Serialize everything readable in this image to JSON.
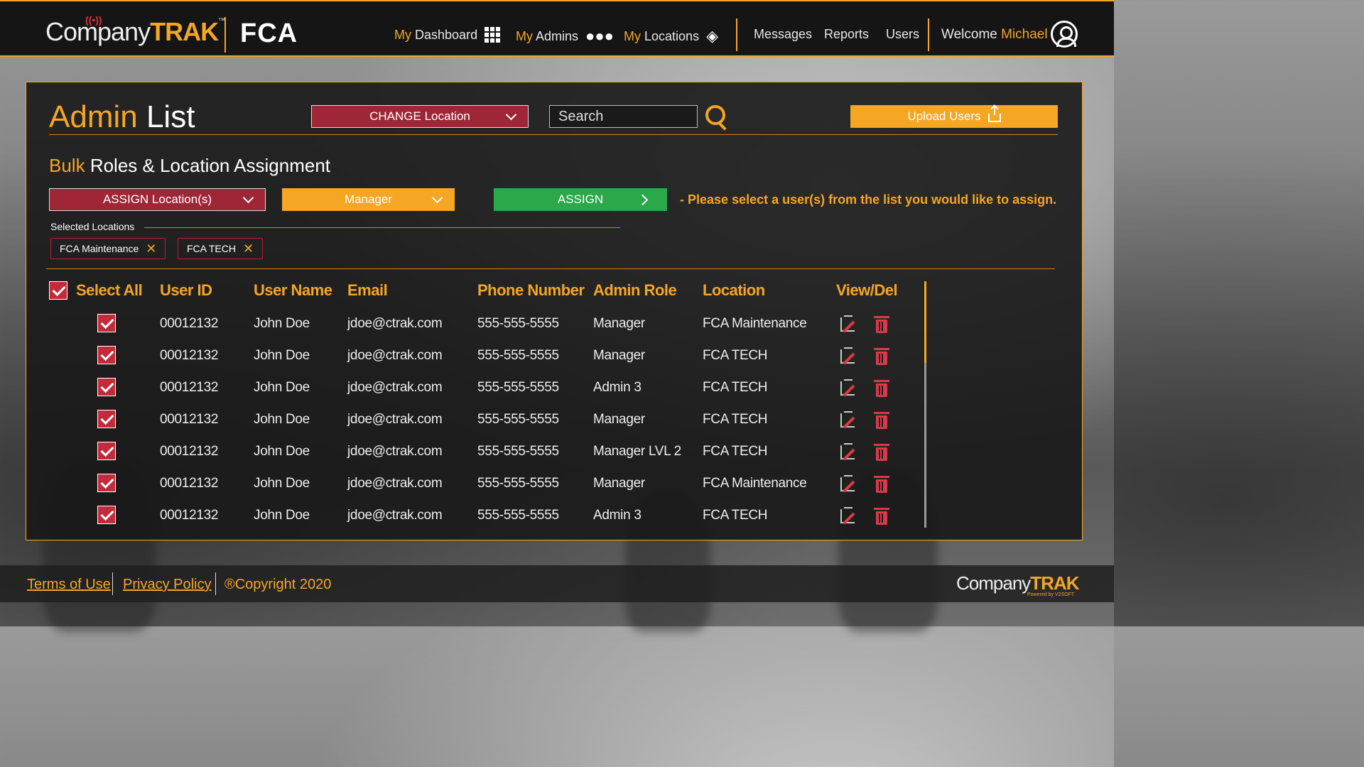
{
  "brand": {
    "company": "Company",
    "trak": "TRAK",
    "tm": "™",
    "client": "FCA",
    "powered_by": "Powered by V2SOFT"
  },
  "nav": {
    "dashboard": {
      "prefix": "My",
      "label": "Dashboard"
    },
    "admins": {
      "prefix": "My",
      "label": "Admins"
    },
    "locations": {
      "prefix": "My",
      "label": "Locations"
    },
    "messages": "Messages",
    "reports": "Reports",
    "users": "Users",
    "welcome": "Welcome",
    "user_name": "Michael"
  },
  "page": {
    "title_accent": "Admin",
    "title_rest": "List",
    "change_location": "CHANGE Location",
    "search_placeholder": "Search",
    "upload_users": "Upload Users"
  },
  "bulk": {
    "title_accent": "Bulk",
    "title_rest": "Roles & Location Assignment",
    "assign_locations": "ASSIGN Location(s)",
    "role_select": "Manager",
    "assign_button": "ASSIGN",
    "notice": "- Please select a user(s) from the list you would like to assign.",
    "selected_label": "Selected Locations",
    "chips": [
      "FCA Maintenance",
      "FCA TECH"
    ]
  },
  "table": {
    "select_all": "Select All",
    "headers": [
      "User ID",
      "User Name",
      "Email",
      "Phone Number",
      "Admin Role",
      "Location",
      "View/Del"
    ],
    "rows": [
      {
        "id": "00012132",
        "name": "John Doe",
        "email": "jdoe@ctrak.com",
        "phone": "555-555-5555",
        "role": "Manager",
        "location": "FCA Maintenance"
      },
      {
        "id": "00012132",
        "name": "John Doe",
        "email": "jdoe@ctrak.com",
        "phone": "555-555-5555",
        "role": "Manager",
        "location": "FCA TECH"
      },
      {
        "id": "00012132",
        "name": "John Doe",
        "email": "jdoe@ctrak.com",
        "phone": "555-555-5555",
        "role": "Admin 3",
        "location": "FCA TECH"
      },
      {
        "id": "00012132",
        "name": "John Doe",
        "email": "jdoe@ctrak.com",
        "phone": "555-555-5555",
        "role": "Manager",
        "location": "FCA TECH"
      },
      {
        "id": "00012132",
        "name": "John Doe",
        "email": "jdoe@ctrak.com",
        "phone": "555-555-5555",
        "role": "Manager LVL 2",
        "location": "FCA TECH"
      },
      {
        "id": "00012132",
        "name": "John Doe",
        "email": "jdoe@ctrak.com",
        "phone": "555-555-5555",
        "role": "Manager",
        "location": "FCA Maintenance"
      },
      {
        "id": "00012132",
        "name": "John Doe",
        "email": "jdoe@ctrak.com",
        "phone": "555-555-5555",
        "role": "Admin 3",
        "location": "FCA TECH"
      }
    ]
  },
  "footer": {
    "terms": "Terms of Use",
    "privacy": "Privacy Policy",
    "copyright": "®Copyright 2020"
  },
  "colors": {
    "accent": "#f5a623",
    "danger": "#b8212f",
    "success": "#2aa84a",
    "bar": "#151515"
  }
}
